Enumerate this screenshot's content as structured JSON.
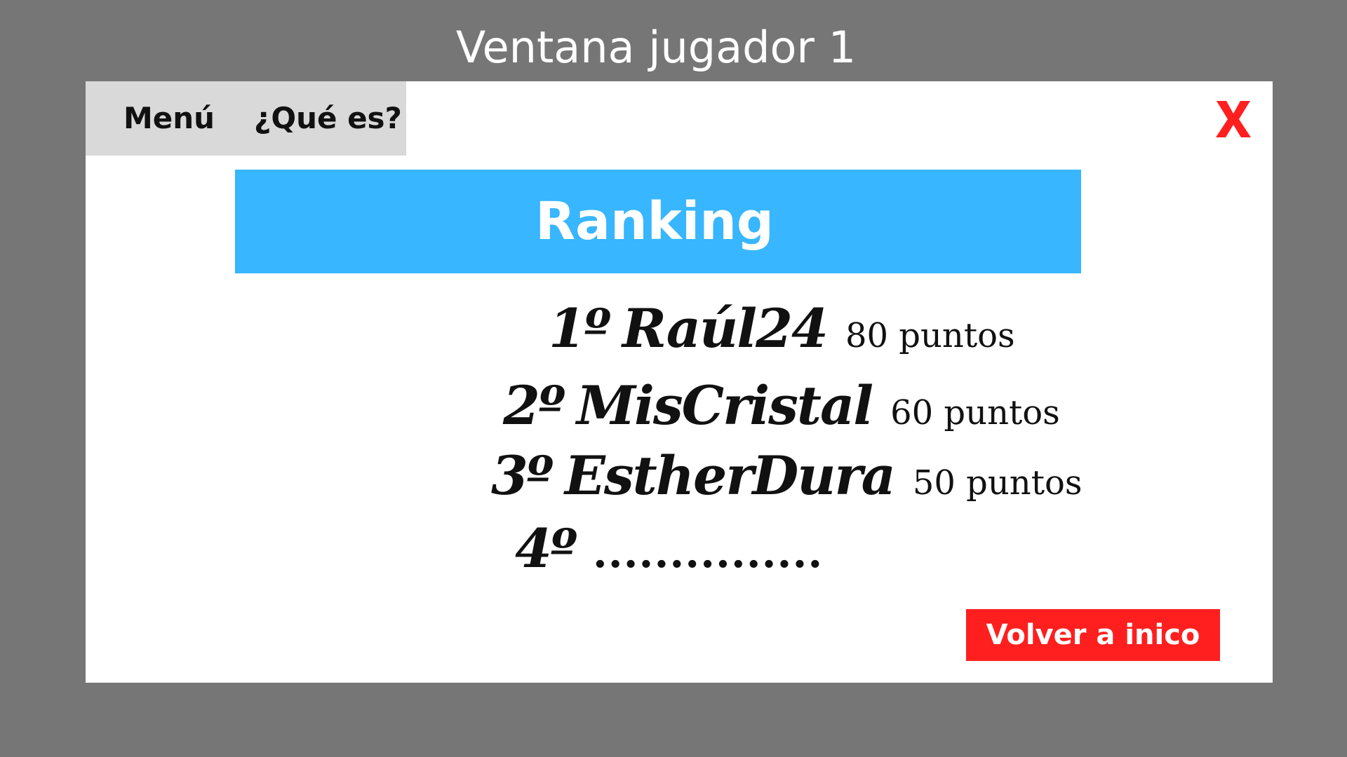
{
  "screen": {
    "title": "Ventana jugador 1"
  },
  "menubar": {
    "menu_label": "Menú",
    "about_label": "¿Qué es?"
  },
  "close": {
    "icon": "close-icon",
    "color": "#ff1f1f"
  },
  "ranking": {
    "title": "Ranking",
    "header_color": "#38b6ff",
    "entries": [
      {
        "position": "1º",
        "name": "Raúl24",
        "points": "80 puntos"
      },
      {
        "position": "2º",
        "name": "MisCristal",
        "points": "60 puntos"
      },
      {
        "position": "3º",
        "name": "EstherDura",
        "points": "50 puntos"
      },
      {
        "position": "4º",
        "placeholder": "..............."
      }
    ]
  },
  "actions": {
    "back_label": "Volver a inico",
    "back_color": "#ff1f1f"
  },
  "colors": {
    "background": "#767676",
    "window": "#ffffff",
    "menubar": "#d9d9d9"
  }
}
